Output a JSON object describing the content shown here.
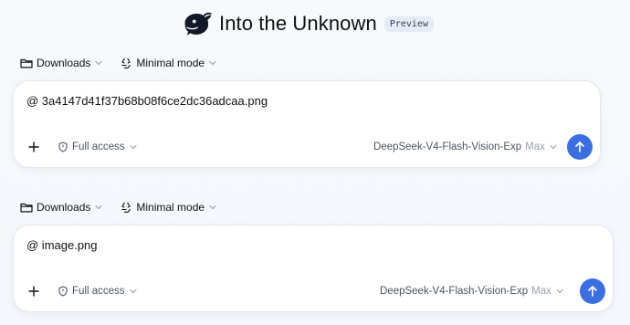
{
  "header": {
    "app_title": "Into the Unknown",
    "badge": "Preview",
    "logo_icon": "whale-logo"
  },
  "composers": [
    {
      "toolbar": {
        "folder": "Downloads",
        "mode": "Minimal mode"
      },
      "prompt": "@ 3a4147d41f37b68b08f6ce2dc36adcaa.png",
      "access": "Full access",
      "model": "DeepSeek-V4-Flash-Vision-Exp",
      "effort": "Max"
    },
    {
      "toolbar": {
        "folder": "Downloads",
        "mode": "Minimal mode"
      },
      "prompt": "@ image.png",
      "access": "Full access",
      "model": "DeepSeek-V4-Flash-Vision-Exp",
      "effort": "Max"
    }
  ],
  "colors": {
    "accent": "#3b6fe0",
    "logo": "#111827",
    "badge_bg": "#e6ecf5"
  }
}
